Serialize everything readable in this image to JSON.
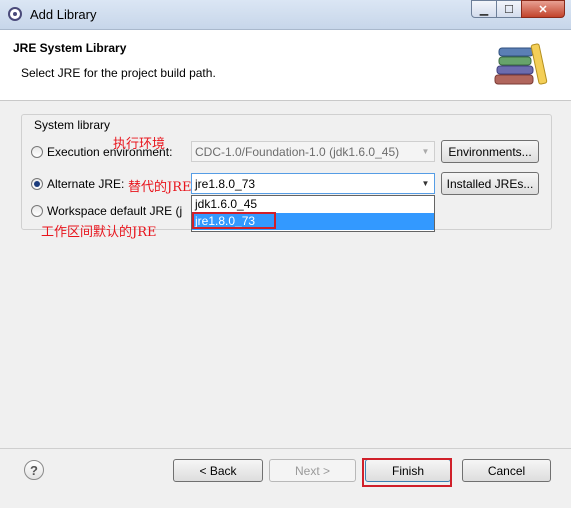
{
  "window": {
    "title": "Add Library"
  },
  "header": {
    "title": "JRE System Library",
    "description": "Select JRE for the project build path."
  },
  "group": {
    "label": "System library"
  },
  "options": {
    "execution": {
      "label": "Execution environment:",
      "value": "CDC-1.0/Foundation-1.0 (jdk1.6.0_45)",
      "button": "Environments..."
    },
    "alternate": {
      "label": "Alternate JRE:",
      "value": "jre1.8.0_73",
      "button": "Installed JREs..."
    },
    "workspace": {
      "label": "Workspace default JRE (j"
    }
  },
  "dropdown": {
    "items": [
      "jdk1.6.0_45",
      "jre1.8.0_73"
    ],
    "selected_index": 1
  },
  "annotations": {
    "execution": "执行环境",
    "alternate": "替代的JRE",
    "workspace": "工作区间默认的JRE"
  },
  "footer": {
    "back": "< Back",
    "next": "Next >",
    "finish": "Finish",
    "cancel": "Cancel"
  },
  "icons": {
    "window": "eclipse-icon",
    "help": "help-icon",
    "library": "library-books-icon"
  },
  "colors": {
    "selection": "#3399ff",
    "annotation": "#e8141c"
  }
}
